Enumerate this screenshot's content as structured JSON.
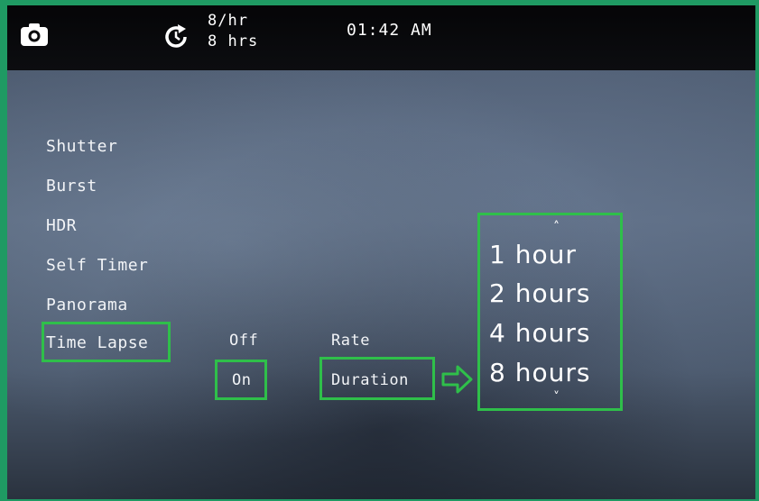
{
  "status": {
    "rate": "8/hr",
    "duration": "8 hrs",
    "time": "01:42 AM"
  },
  "menu": {
    "items": [
      {
        "label": "Shutter"
      },
      {
        "label": "Burst"
      },
      {
        "label": "HDR"
      },
      {
        "label": "Self Timer"
      },
      {
        "label": "Panorama"
      },
      {
        "label": "Time Lapse",
        "selected": true
      }
    ]
  },
  "timelapse": {
    "off_label": "Off",
    "on_label": "On",
    "rate_label": "Rate",
    "duration_label": "Duration"
  },
  "duration_list": {
    "up_chevron": "˄",
    "down_chevron": "˅",
    "options": [
      "1 hour",
      "2 hours",
      "4 hours",
      "8 hours"
    ]
  },
  "colors": {
    "highlight": "#2fbf4a",
    "background": "#4f5d72"
  }
}
